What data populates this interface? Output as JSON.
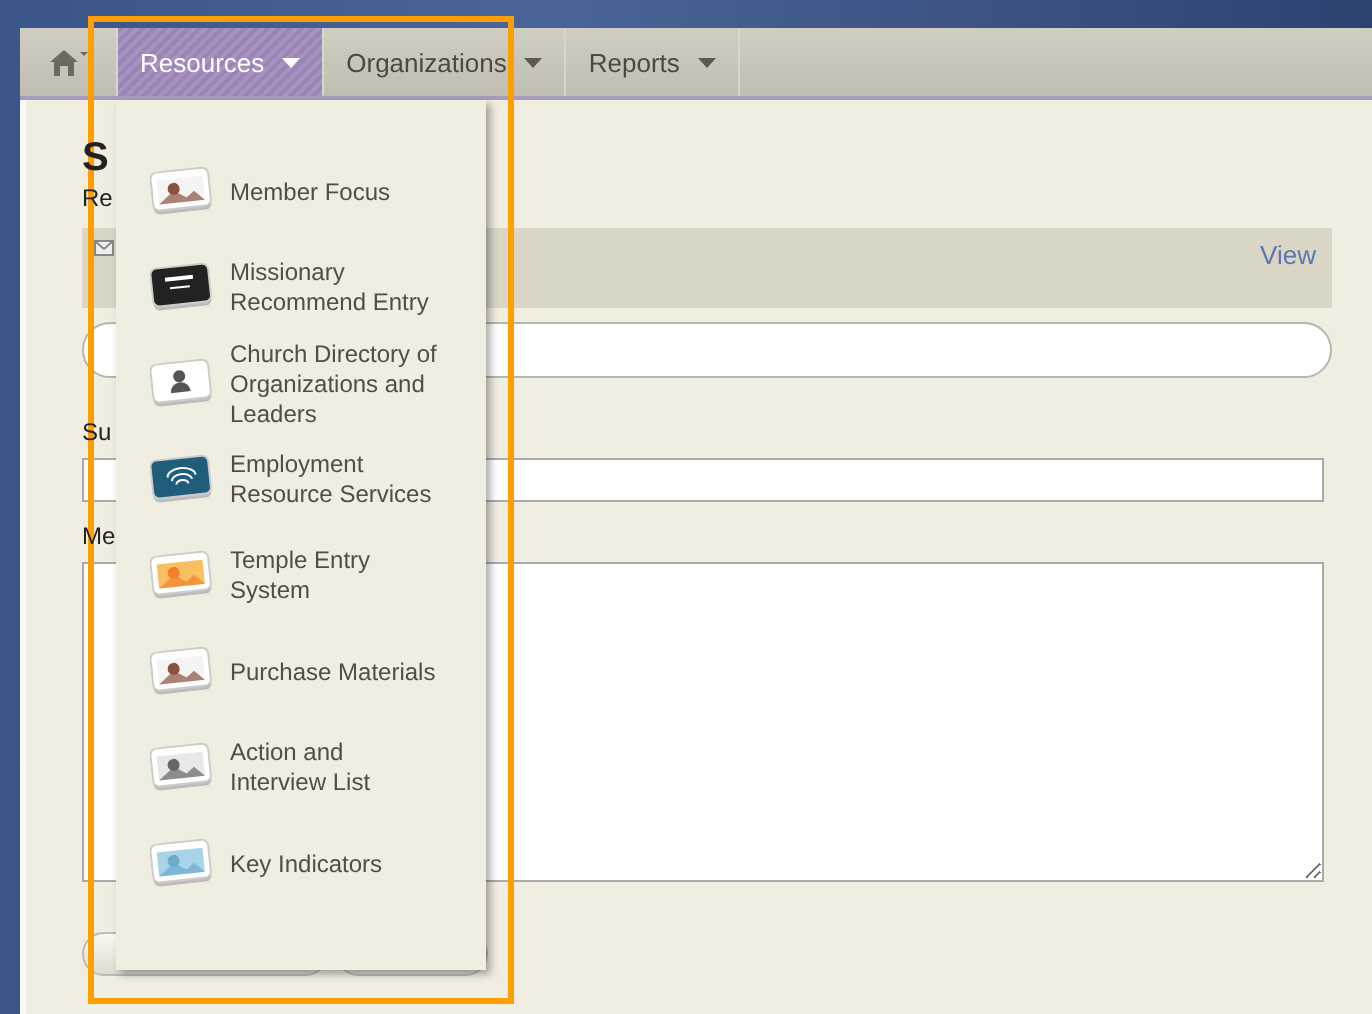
{
  "nav": {
    "tabs": [
      {
        "label": "Resources",
        "selected": true
      },
      {
        "label": "Organizations",
        "selected": false
      },
      {
        "label": "Reports",
        "selected": false
      }
    ]
  },
  "form": {
    "heading": "S",
    "recipients_label": "Re",
    "view_link": "View",
    "subject_label": "Su",
    "message_label": "Me"
  },
  "menu": {
    "items": [
      {
        "label": "Member Focus",
        "kind": "photo"
      },
      {
        "label": "Missionary Recommend Entry",
        "kind": "card"
      },
      {
        "label": "Church Directory of Organizations and Leaders",
        "kind": "person"
      },
      {
        "label": "Employment Resource Services",
        "kind": "logo"
      },
      {
        "label": "Temple Entry System",
        "kind": "sunset"
      },
      {
        "label": "Purchase Materials",
        "kind": "photo"
      },
      {
        "label": "Action and Interview List",
        "kind": "dark"
      },
      {
        "label": "Key Indicators",
        "kind": "sky"
      }
    ]
  }
}
